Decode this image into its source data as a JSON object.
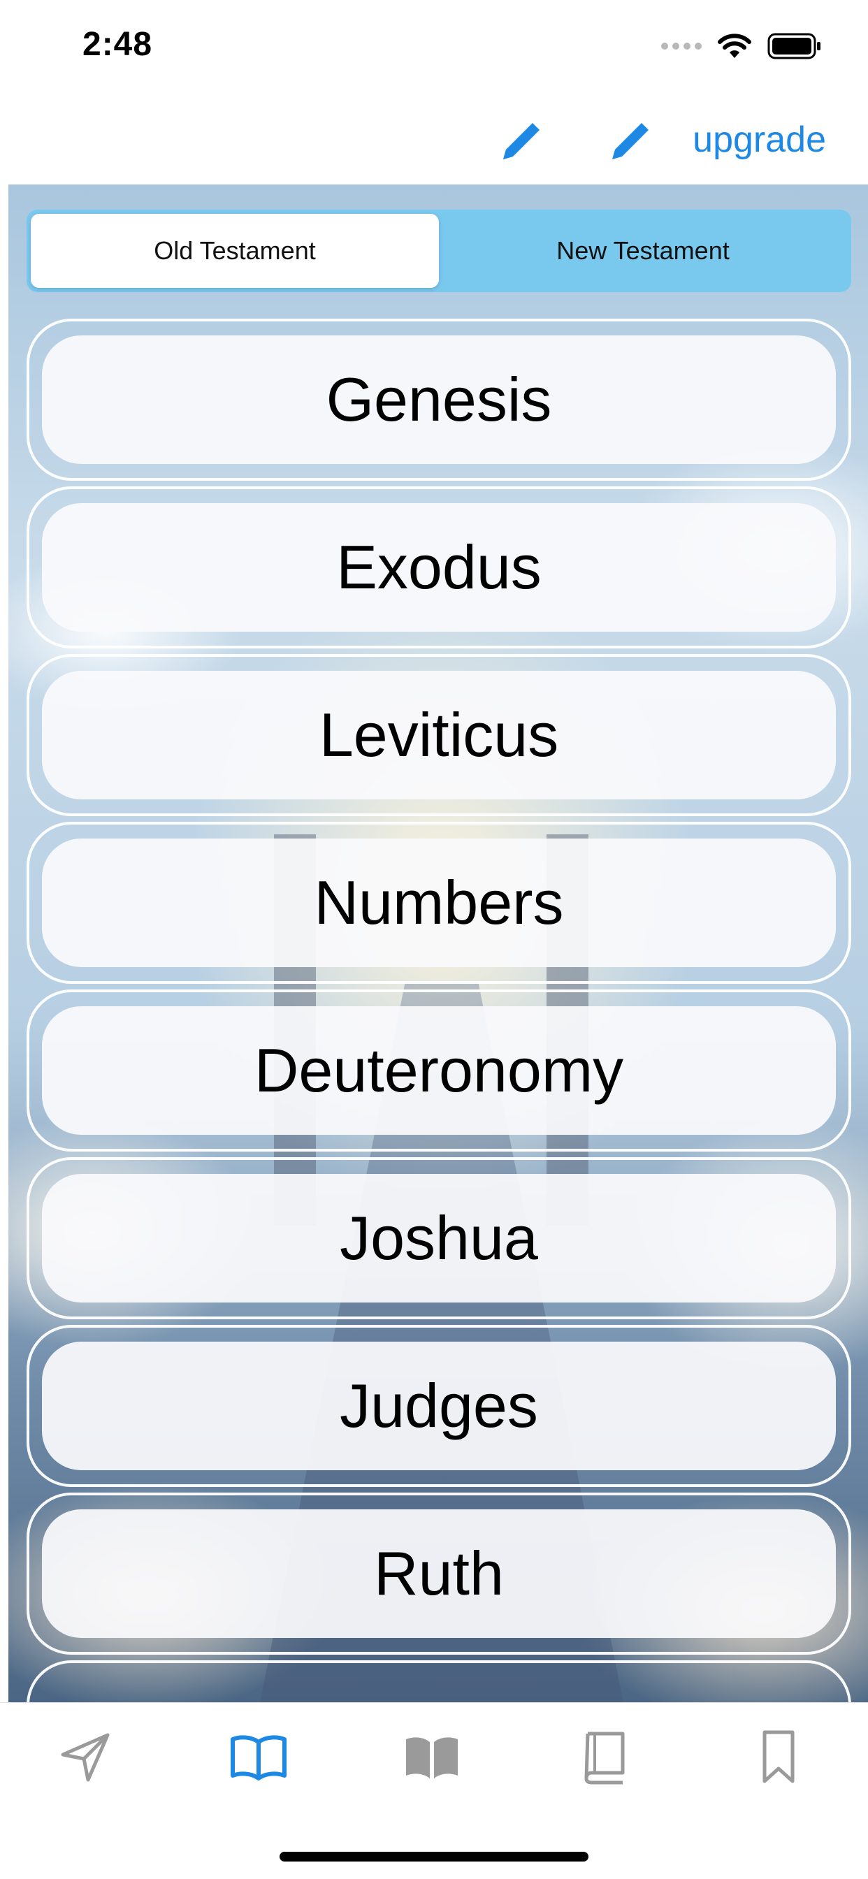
{
  "status_bar": {
    "time": "2:48"
  },
  "nav": {
    "upgrade_label": "upgrade",
    "edit_icon": "pencil-icon"
  },
  "segments": {
    "old": "Old Testament",
    "new": "New Testament",
    "selected": "Old Testament"
  },
  "books": [
    "Genesis",
    "Exodus",
    "Leviticus",
    "Numbers",
    "Deuteronomy",
    "Joshua",
    "Judges",
    "Ruth"
  ],
  "tabs": [
    {
      "icon": "paper-plane-icon",
      "active": false
    },
    {
      "icon": "open-book-icon",
      "active": true
    },
    {
      "icon": "open-book-filled-icon",
      "active": false
    },
    {
      "icon": "closed-book-icon",
      "active": false
    },
    {
      "icon": "bookmark-icon",
      "active": false
    }
  ],
  "colors": {
    "accent": "#1e88e5",
    "segment_bg": "#79c8ee",
    "inactive_tab": "#9a9a9a"
  }
}
